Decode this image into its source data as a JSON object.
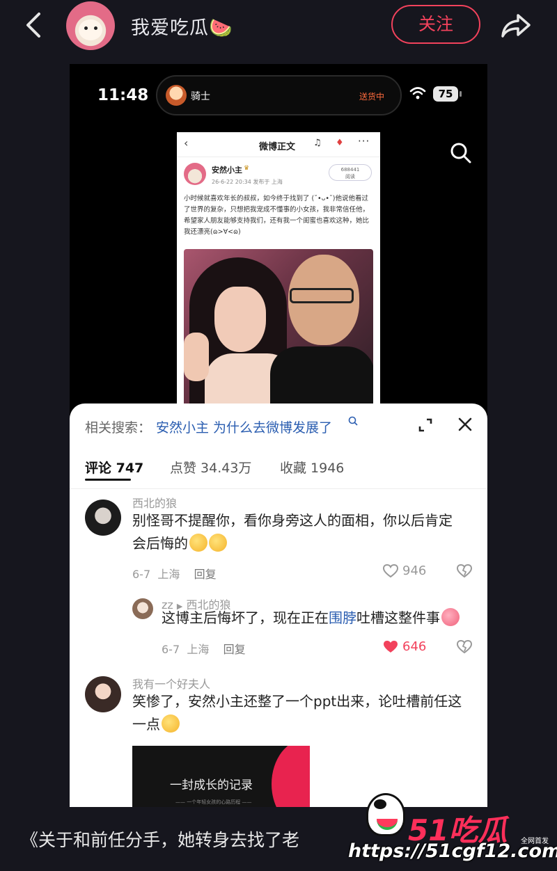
{
  "header": {
    "username": "我爱吃瓜",
    "username_emoji": "🍉",
    "follow_label": "关注"
  },
  "phone": {
    "time": "11:48",
    "island": {
      "rider": "骑士",
      "status": "送货中"
    },
    "battery": "75"
  },
  "weibo_card": {
    "title": "微博正文",
    "author": "安然小主",
    "meta": "26-6-22 20:34  发布于 上海",
    "read_count": "688441",
    "read_label": "阅读",
    "body": "小时候就喜欢年长的叔叔，如今终于找到了 (˘•ᴗ•˘)他说他看过了世界的复杂，只想把我宠成不懂事的小女孩，我非常信任他，希望家人朋友能够支持我们，还有我一个闺蜜也喜欢这种，她比我还漂亮(ɷ>∀<ɷ)"
  },
  "sheet": {
    "related_label": "相关搜索：",
    "related_query": "安然小主 为什么去微博发展了",
    "tabs": [
      {
        "label": "评论 747",
        "active": true
      },
      {
        "label": "点赞 34.43万",
        "active": false
      },
      {
        "label": "收藏 1946",
        "active": false
      }
    ],
    "comments": [
      {
        "name": "西北的狼",
        "text_line1": "别怪哥不提醒你，看你身旁这人的面相，你以后肯定",
        "text_line2": "会后悔的",
        "date": "6-7",
        "location": "上海",
        "reply_label": "回复",
        "likes": "946"
      },
      {
        "name": "zz",
        "reply_to": "西北的狼",
        "text_before": "这博主后悔坏了，现在正在",
        "text_link": "围脖",
        "text_after": "吐槽这整件事",
        "date": "6-7",
        "location": "上海",
        "reply_label": "回复",
        "likes": "646"
      },
      {
        "name": "我有一个好夫人",
        "text_line1": "笑惨了，安然小主还整了一个ppt出来，论吐槽前任这",
        "text_line2": "一点",
        "attachment_title": "一封成长的记录",
        "attachment_subtitle": "—— 一个年轻女孩的心路历程 ——"
      }
    ]
  },
  "caption": "《关于和前任分手，她转身去找了老",
  "watermark": {
    "logo": "51吃瓜",
    "tag": "全网首发",
    "url": "https://51cgf12.com"
  },
  "colors": {
    "accent": "#f2425c",
    "link": "#2a5db0",
    "background": "#16161e"
  }
}
